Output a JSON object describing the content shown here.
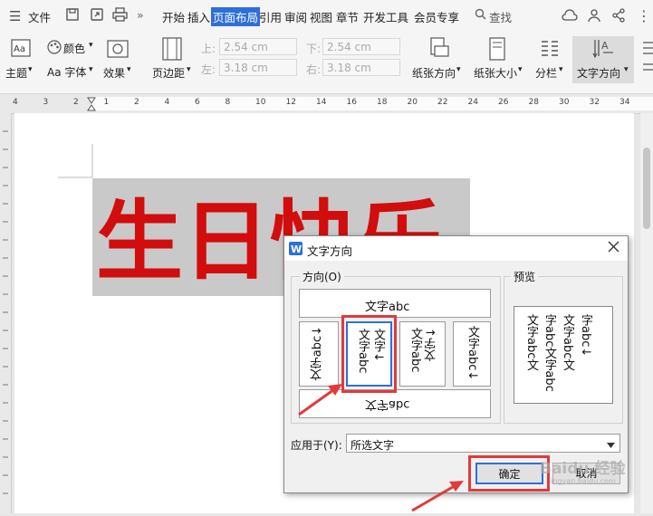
{
  "menubar": {
    "file": "文件",
    "tabs": [
      "开始",
      "插入",
      "页面布局",
      "引用",
      "审阅",
      "视图",
      "章节",
      "开发工具",
      "会员专享"
    ],
    "active_tab": "页面布局",
    "search": "查找",
    "more": "»"
  },
  "ribbon": {
    "theme": "主题",
    "colors": "颜色",
    "fonts": "Aa 字体",
    "effects": "效果",
    "margins": "页边距",
    "top_label": "上:",
    "top_value": "2.54 cm",
    "bottom_label": "下:",
    "bottom_value": "2.54 cm",
    "left_label": "左:",
    "left_value": "3.18 cm",
    "right_label": "右:",
    "right_value": "3.18 cm",
    "orientation": "纸张方向",
    "size": "纸张大小",
    "columns": "分栏",
    "text_direction": "文字方向",
    "dropdown": "▾"
  },
  "ruler": [
    "4",
    "3",
    "2",
    "1",
    "2",
    "4",
    "6",
    "8",
    "10",
    "12",
    "14",
    "16",
    "18",
    "20",
    "22",
    "24",
    "26",
    "28",
    "30",
    "32",
    "34"
  ],
  "document": {
    "text": "生日快乐"
  },
  "dialog": {
    "title": "文字方向",
    "direction_group": "方向(O)",
    "preview_group": "预览",
    "opt_horizontal": "文字abc",
    "opt_rotated_left": "文字abc↓",
    "opt_vertical_col1": "文字↓",
    "opt_vertical_col2": "文字abc",
    "opt_stack_col1": "文字↓",
    "opt_stack_col2": "文字abc",
    "opt_rotated_right": "文字abc↓",
    "opt_upside_down": "文字abc",
    "preview_cols": [
      "字abc↓",
      "文字abc文",
      "字abc文字abc",
      "文字abc文"
    ],
    "apply_label": "应用于(Y):",
    "apply_value": "所选文字",
    "ok": "确定",
    "cancel": "取消"
  },
  "watermark": "Baidu 经验",
  "watermark_url": "jingyan.baidu.com",
  "colors": {
    "accent": "#2e6fd8",
    "doc_text": "#d10d0d",
    "highlight": "#e23a3a"
  }
}
